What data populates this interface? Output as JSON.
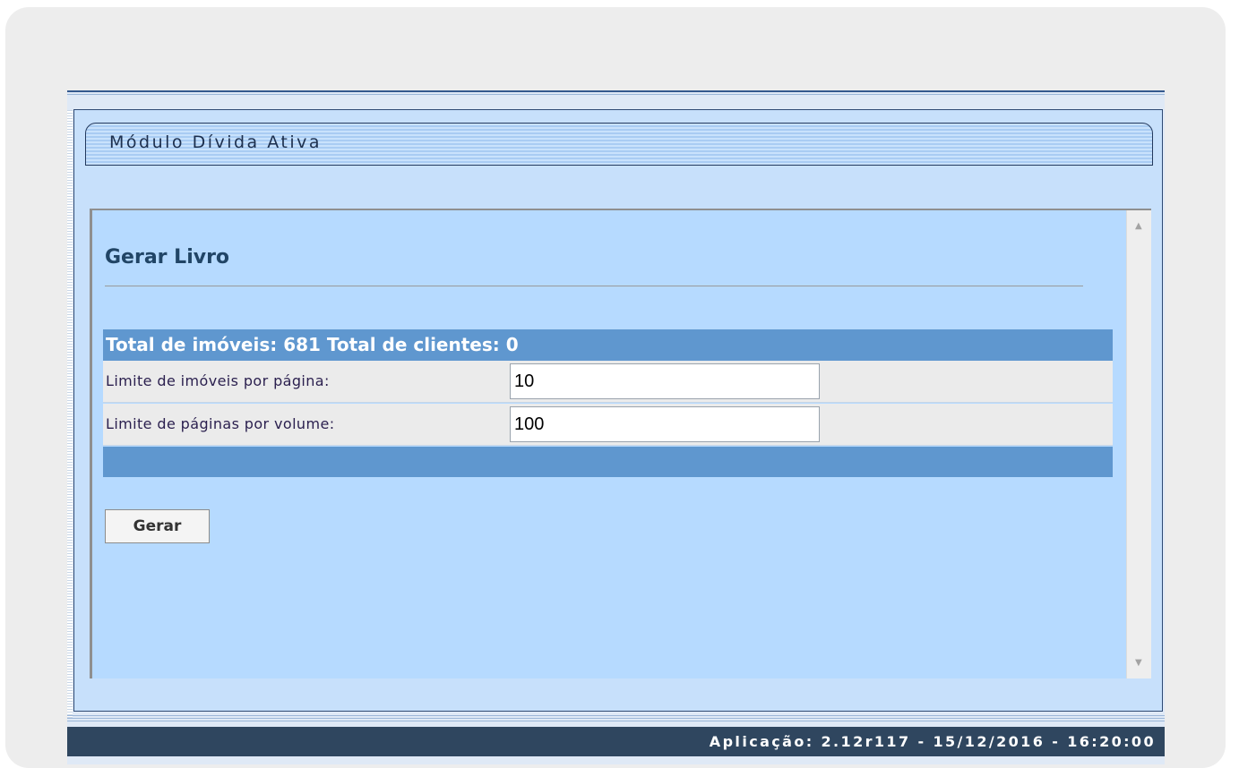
{
  "module": {
    "title": "Módulo Dívida Ativa"
  },
  "page": {
    "title": "Gerar Livro"
  },
  "table": {
    "header": "Total de imóveis: 681 Total de clientes: 0",
    "rows": [
      {
        "label": "Limite de imóveis por página:",
        "value": "10"
      },
      {
        "label": "Limite de páginas por volume:",
        "value": "100"
      }
    ]
  },
  "actions": {
    "generate_label": "Gerar"
  },
  "status": {
    "text": "Aplicação: 2.12r117 - 15/12/2016 - 16:20:00"
  },
  "icons": {
    "scroll_up": "scroll-up-arrow-icon",
    "scroll_down": "scroll-down-arrow-icon"
  },
  "colors": {
    "header_bar": "#5f97cf",
    "panel": "#b6daff",
    "status_bar": "#2f465f"
  }
}
